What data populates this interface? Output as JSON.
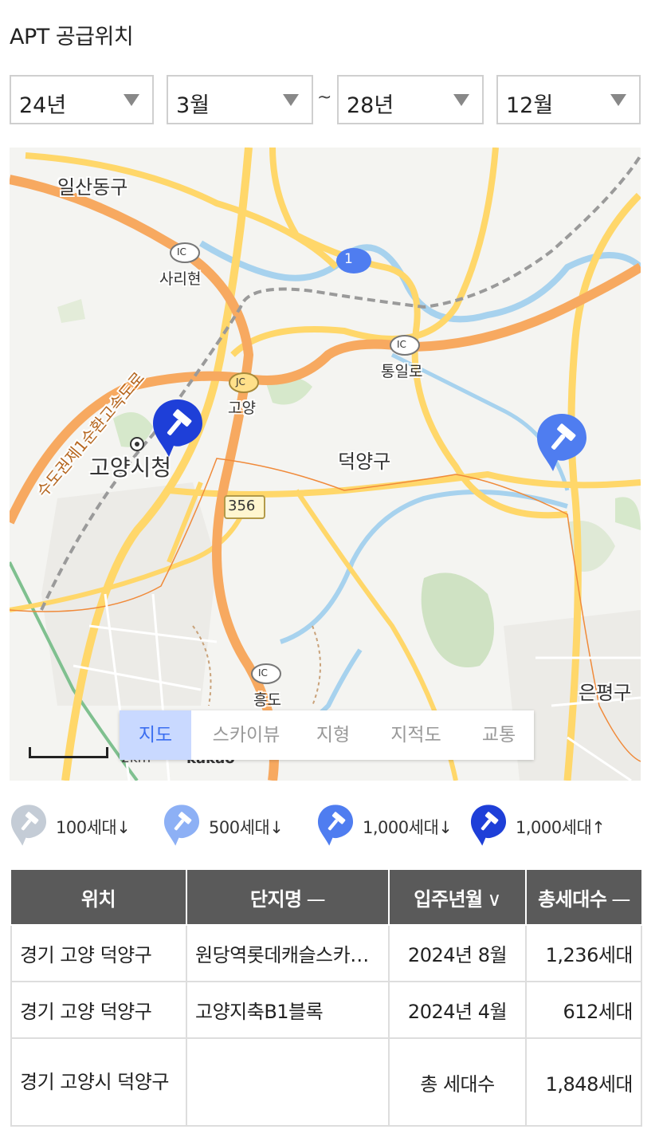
{
  "title": "APT 공급위치",
  "filters": {
    "start_year": "24년",
    "start_month": "3월",
    "separator": "~",
    "end_year": "28년",
    "end_month": "12월"
  },
  "map": {
    "labels": {
      "district1": "일산동구",
      "district2": "덕양구",
      "district3": "은평구",
      "city_hall": "고양시청",
      "ic1": "사리현",
      "ic2": "통일로",
      "jc": "고양",
      "ic3": "흥도",
      "expressway": "수도권제1순환고속도로",
      "road_356": "356",
      "road_1": "1",
      "ic_badge": "IC",
      "jc_badge": "JC"
    },
    "tabs": [
      {
        "label": "지도",
        "active": true
      },
      {
        "label": "스카이뷰",
        "active": false
      },
      {
        "label": "지형",
        "active": false
      },
      {
        "label": "지적도",
        "active": false
      },
      {
        "label": "교통",
        "active": false
      }
    ],
    "scale": "2km",
    "provider": "kakao"
  },
  "legend": [
    {
      "label": "100세대↓",
      "color": "#c4ccd6"
    },
    {
      "label": "500세대↓",
      "color": "#8db0f5"
    },
    {
      "label": "1,000세대↓",
      "color": "#4f7df0"
    },
    {
      "label": "1,000세대↑",
      "color": "#1e3fd8"
    }
  ],
  "table": {
    "headers": [
      {
        "label": "위치",
        "sort": ""
      },
      {
        "label": "단지명",
        "sort": "—"
      },
      {
        "label": "입주년월",
        "sort": "∨"
      },
      {
        "label": "총세대수",
        "sort": "—"
      }
    ],
    "rows": [
      {
        "location": "경기 고양 덕양구",
        "name": "원당역롯데캐슬스카이엘",
        "date": "2024년 8월",
        "units": "1,236세대"
      },
      {
        "location": "경기 고양 덕양구",
        "name": "고양지축B1블록",
        "date": "2024년 4월",
        "units": "612세대"
      }
    ],
    "total": {
      "location": "경기 고양시 덕양구",
      "label": "총 세대수",
      "units": "1,848세대"
    }
  },
  "colors": {
    "header_bg": "#5a5a5a",
    "accent": "#3b6ef0"
  }
}
